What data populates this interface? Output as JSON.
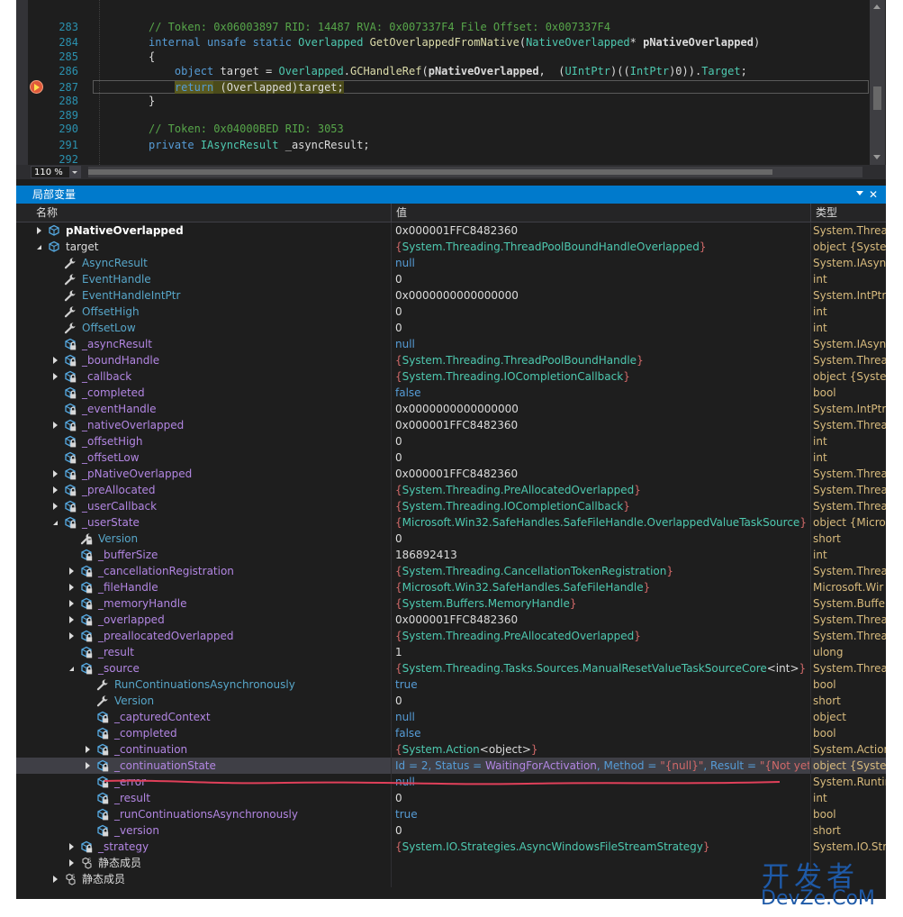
{
  "editor": {
    "zoom": "110 %",
    "lines": [
      {
        "n": "283",
        "segments": [
          [
            "cm",
            "// Token: 0x06003897 RID: 14487 RVA: 0x007337F4 File Offset: 0x007337F4"
          ]
        ]
      },
      {
        "n": "284",
        "segments": [
          [
            "k",
            "internal unsafe static "
          ],
          [
            "ty",
            "Overlapped "
          ],
          [
            "m",
            "GetOverlappedFromNative"
          ],
          [
            "",
            "("
          ],
          [
            "ty",
            "NativeOverlapped"
          ],
          [
            "",
            "* "
          ],
          [
            "b",
            "pNativeOverlapped"
          ],
          [
            "",
            ")"
          ]
        ]
      },
      {
        "n": "285",
        "segments": [
          [
            "",
            "{"
          ]
        ]
      },
      {
        "n": "286",
        "segments": [
          [
            "",
            "    "
          ],
          [
            "k",
            "object "
          ],
          [
            "",
            "target = "
          ],
          [
            "ty",
            "Overlapped"
          ],
          [
            "",
            "."
          ],
          [
            "m",
            "GCHandleRef"
          ],
          [
            "",
            "("
          ],
          [
            "b",
            "pNativeOverlapped"
          ],
          [
            "",
            ",  ("
          ],
          [
            "ty",
            "UIntPtr"
          ],
          [
            "",
            ")(("
          ],
          [
            "ty",
            "IntPtr"
          ],
          [
            "",
            ")0))."
          ],
          [
            "ty",
            "Target"
          ],
          [
            "",
            ";"
          ]
        ]
      },
      {
        "n": "287",
        "segments": [
          [
            "",
            "    "
          ],
          [
            "khl",
            "return"
          ],
          [
            "hl",
            " (Overlapped)target;"
          ]
        ]
      },
      {
        "n": "288",
        "segments": [
          [
            "",
            "}"
          ]
        ]
      },
      {
        "n": "289",
        "segments": []
      },
      {
        "n": "290",
        "segments": [
          [
            "cm",
            "// Token: 0x04000BED RID: 3053"
          ]
        ]
      },
      {
        "n": "291",
        "segments": [
          [
            "k",
            "private "
          ],
          [
            "ty",
            "IAsyncResult "
          ],
          [
            "",
            "_asyncResult;"
          ]
        ]
      },
      {
        "n": "292",
        "segments": []
      }
    ]
  },
  "locals": {
    "title": "局部变量",
    "close": "✕",
    "headers": {
      "name": "名称",
      "value": "值",
      "type": "类型"
    },
    "rows": [
      {
        "d": 0,
        "tw": "col",
        "ic": "field",
        "name": "pNativeOverlapped",
        "nc": "pnb",
        "value": [
          [
            "vd",
            "0x000001FFC8482360"
          ]
        ],
        "type": "System.Threa"
      },
      {
        "d": 0,
        "tw": "exp",
        "ic": "field",
        "name": "target",
        "nc": "vd",
        "value": [
          [
            "br",
            "{"
          ],
          [
            "th",
            "System.Threading."
          ],
          [
            "tk",
            "ThreadPoolBoundHandleOverlapped"
          ],
          [
            "br",
            "}"
          ]
        ],
        "type": "object {Syster"
      },
      {
        "d": 1,
        "tw": "",
        "ic": "wrench",
        "name": "AsyncResult",
        "nc": "vc",
        "value": [
          [
            "kw",
            "null"
          ]
        ],
        "type": "System.IAsync"
      },
      {
        "d": 1,
        "tw": "",
        "ic": "wrench",
        "name": "EventHandle",
        "nc": "vc",
        "value": [
          [
            "vd",
            "0"
          ]
        ],
        "type": "int"
      },
      {
        "d": 1,
        "tw": "",
        "ic": "wrench",
        "name": "EventHandleIntPtr",
        "nc": "vc",
        "value": [
          [
            "vd",
            "0x0000000000000000"
          ]
        ],
        "type": "System.IntPtr"
      },
      {
        "d": 1,
        "tw": "",
        "ic": "wrench",
        "name": "OffsetHigh",
        "nc": "vc",
        "value": [
          [
            "vd",
            "0"
          ]
        ],
        "type": "int"
      },
      {
        "d": 1,
        "tw": "",
        "ic": "wrench",
        "name": "OffsetLow",
        "nc": "vc",
        "value": [
          [
            "vd",
            "0"
          ]
        ],
        "type": "int"
      },
      {
        "d": 1,
        "tw": "",
        "ic": "fieldlock",
        "name": "_asyncResult",
        "nc": "pn",
        "value": [
          [
            "kw",
            "null"
          ]
        ],
        "type": "System.IAsync"
      },
      {
        "d": 1,
        "tw": "col",
        "ic": "fieldlock",
        "name": "_boundHandle",
        "nc": "pn",
        "value": [
          [
            "br",
            "{"
          ],
          [
            "th",
            "System.Threading."
          ],
          [
            "tk",
            "ThreadPoolBoundHandle"
          ],
          [
            "br",
            "}"
          ]
        ],
        "type": "System.Threa"
      },
      {
        "d": 1,
        "tw": "col",
        "ic": "fieldlock",
        "name": "_callback",
        "nc": "pn",
        "value": [
          [
            "br",
            "{"
          ],
          [
            "th",
            "System.Threading."
          ],
          [
            "tk",
            "IOCompletionCallback"
          ],
          [
            "br",
            "}"
          ]
        ],
        "type": "object {Syster"
      },
      {
        "d": 1,
        "tw": "",
        "ic": "fieldlock",
        "name": "_completed",
        "nc": "pn",
        "value": [
          [
            "kw",
            "false"
          ]
        ],
        "type": "bool"
      },
      {
        "d": 1,
        "tw": "",
        "ic": "fieldlock",
        "name": "_eventHandle",
        "nc": "pn",
        "value": [
          [
            "vd",
            "0x0000000000000000"
          ]
        ],
        "type": "System.IntPtr"
      },
      {
        "d": 1,
        "tw": "col",
        "ic": "fieldlock",
        "name": "_nativeOverlapped",
        "nc": "pn",
        "value": [
          [
            "vd",
            "0x000001FFC8482360"
          ]
        ],
        "type": "System.Threa"
      },
      {
        "d": 1,
        "tw": "",
        "ic": "fieldlock",
        "name": "_offsetHigh",
        "nc": "pn",
        "value": [
          [
            "vd",
            "0"
          ]
        ],
        "type": "int"
      },
      {
        "d": 1,
        "tw": "",
        "ic": "fieldlock",
        "name": "_offsetLow",
        "nc": "pn",
        "value": [
          [
            "vd",
            "0"
          ]
        ],
        "type": "int"
      },
      {
        "d": 1,
        "tw": "col",
        "ic": "fieldlock",
        "name": "_pNativeOverlapped",
        "nc": "pn",
        "value": [
          [
            "vd",
            "0x000001FFC8482360"
          ]
        ],
        "type": "System.Threa"
      },
      {
        "d": 1,
        "tw": "col",
        "ic": "fieldlock",
        "name": "_preAllocated",
        "nc": "pn",
        "value": [
          [
            "br",
            "{"
          ],
          [
            "th",
            "System.Threading."
          ],
          [
            "tk",
            "PreAllocatedOverlapped"
          ],
          [
            "br",
            "}"
          ]
        ],
        "type": "System.Threa"
      },
      {
        "d": 1,
        "tw": "col",
        "ic": "fieldlock",
        "name": "_userCallback",
        "nc": "pn",
        "value": [
          [
            "br",
            "{"
          ],
          [
            "th",
            "System.Threading."
          ],
          [
            "tk",
            "IOCompletionCallback"
          ],
          [
            "br",
            "}"
          ]
        ],
        "type": "System.Threa"
      },
      {
        "d": 1,
        "tw": "exp",
        "ic": "fieldlock",
        "name": "_userState",
        "nc": "pn",
        "value": [
          [
            "br",
            "{"
          ],
          [
            "th",
            "Microsoft.Win32.SafeHandles.SafeFileHandle."
          ],
          [
            "tk",
            "OverlappedValueTaskSource"
          ],
          [
            "br",
            "}"
          ]
        ],
        "type": "object {Micro"
      },
      {
        "d": 2,
        "tw": "",
        "ic": "wrenchlock",
        "name": "Version",
        "nc": "vc",
        "value": [
          [
            "vd",
            "0"
          ]
        ],
        "type": "short"
      },
      {
        "d": 2,
        "tw": "",
        "ic": "fieldlock",
        "name": "_bufferSize",
        "nc": "pn",
        "value": [
          [
            "vd",
            "186892413"
          ]
        ],
        "type": "int"
      },
      {
        "d": 2,
        "tw": "col",
        "ic": "fieldlock",
        "name": "_cancellationRegistration",
        "nc": "pn",
        "value": [
          [
            "br",
            "{"
          ],
          [
            "th",
            "System.Threading."
          ],
          [
            "tk",
            "CancellationTokenRegistration"
          ],
          [
            "br",
            "}"
          ]
        ],
        "type": "System.Threa"
      },
      {
        "d": 2,
        "tw": "col",
        "ic": "fieldlock",
        "name": "_fileHandle",
        "nc": "pn",
        "value": [
          [
            "br",
            "{"
          ],
          [
            "th",
            "Microsoft.Win32.SafeHandles."
          ],
          [
            "tk",
            "SafeFileHandle"
          ],
          [
            "br",
            "}"
          ]
        ],
        "type": "Microsoft.Wir"
      },
      {
        "d": 2,
        "tw": "col",
        "ic": "fieldlock",
        "name": "_memoryHandle",
        "nc": "pn",
        "value": [
          [
            "br",
            "{"
          ],
          [
            "th",
            "System.Buffers."
          ],
          [
            "tk",
            "MemoryHandle"
          ],
          [
            "br",
            "}"
          ]
        ],
        "type": "System.Buffer"
      },
      {
        "d": 2,
        "tw": "col",
        "ic": "fieldlock",
        "name": "_overlapped",
        "nc": "pn",
        "value": [
          [
            "vd",
            "0x000001FFC8482360"
          ]
        ],
        "type": "System.Threa"
      },
      {
        "d": 2,
        "tw": "col",
        "ic": "fieldlock",
        "name": "_preallocatedOverlapped",
        "nc": "pn",
        "value": [
          [
            "br",
            "{"
          ],
          [
            "th",
            "System.Threading."
          ],
          [
            "tk",
            "PreAllocatedOverlapped"
          ],
          [
            "br",
            "}"
          ]
        ],
        "type": "System.Threa"
      },
      {
        "d": 2,
        "tw": "",
        "ic": "fieldlock",
        "name": "_result",
        "nc": "pn",
        "value": [
          [
            "vd",
            "1"
          ]
        ],
        "type": "ulong"
      },
      {
        "d": 2,
        "tw": "exp",
        "ic": "fieldlock",
        "name": "_source",
        "nc": "pn",
        "value": [
          [
            "br",
            "{"
          ],
          [
            "th",
            "System.Threading.Tasks.Sources."
          ],
          [
            "tk",
            "ManualResetValueTaskSourceCore"
          ],
          [
            "vd",
            "<int>"
          ],
          [
            "br",
            "}"
          ]
        ],
        "type": "System.Threa"
      },
      {
        "d": 3,
        "tw": "",
        "ic": "wrench",
        "name": "RunContinuationsAsynchronously",
        "nc": "vc",
        "value": [
          [
            "kw",
            "true"
          ]
        ],
        "type": "bool"
      },
      {
        "d": 3,
        "tw": "",
        "ic": "wrench",
        "name": "Version",
        "nc": "vc",
        "value": [
          [
            "vd",
            "0"
          ]
        ],
        "type": "short"
      },
      {
        "d": 3,
        "tw": "",
        "ic": "fieldlock",
        "name": "_capturedContext",
        "nc": "pn",
        "value": [
          [
            "kw",
            "null"
          ]
        ],
        "type": "object"
      },
      {
        "d": 3,
        "tw": "",
        "ic": "fieldlock",
        "name": "_completed",
        "nc": "pn",
        "value": [
          [
            "kw",
            "false"
          ]
        ],
        "type": "bool"
      },
      {
        "d": 3,
        "tw": "col",
        "ic": "fieldlock",
        "name": "_continuation",
        "nc": "pn",
        "value": [
          [
            "br",
            "{"
          ],
          [
            "th",
            "System."
          ],
          [
            "tk",
            "Action"
          ],
          [
            "vd",
            "<object>"
          ],
          [
            "br",
            "}"
          ]
        ],
        "type": "System.Action"
      },
      {
        "d": 3,
        "tw": "col",
        "ic": "fieldlock",
        "name": "_continuationState",
        "nc": "pn",
        "sel": true,
        "value": [
          [
            "kw",
            "Id = 2, Status = "
          ],
          [
            "pn",
            "WaitingForActivation"
          ],
          [
            "kw",
            ", Method = "
          ],
          [
            "br",
            "\"{null}\""
          ],
          [
            "kw",
            ", Result = "
          ],
          [
            "br",
            "\"{Not yet c..."
          ]
        ],
        "type": "object {Syster"
      },
      {
        "d": 3,
        "tw": "",
        "ic": "fieldlock",
        "name": "_error",
        "nc": "pn",
        "value": [
          [
            "kw",
            "null"
          ]
        ],
        "type": "System.Runtir"
      },
      {
        "d": 3,
        "tw": "",
        "ic": "fieldlock",
        "name": "_result",
        "nc": "pn",
        "value": [
          [
            "vd",
            "0"
          ]
        ],
        "type": "int"
      },
      {
        "d": 3,
        "tw": "",
        "ic": "fieldlock",
        "name": "_runContinuationsAsynchronously",
        "nc": "pn",
        "value": [
          [
            "kw",
            "true"
          ]
        ],
        "type": "bool"
      },
      {
        "d": 3,
        "tw": "",
        "ic": "fieldlock",
        "name": "_version",
        "nc": "pn",
        "value": [
          [
            "vd",
            "0"
          ]
        ],
        "type": "short"
      },
      {
        "d": 2,
        "tw": "col",
        "ic": "fieldlock",
        "name": "_strategy",
        "nc": "pn",
        "value": [
          [
            "br",
            "{"
          ],
          [
            "th",
            "System.IO.Strategies."
          ],
          [
            "tk",
            "AsyncWindowsFileStreamStrategy"
          ],
          [
            "br",
            "}"
          ]
        ],
        "type": "System.IO.Str"
      },
      {
        "d": 2,
        "tw": "col",
        "ic": "static",
        "name": "静态成员",
        "nc": "vd",
        "value": [],
        "type": ""
      },
      {
        "d": 1,
        "tw": "col",
        "ic": "static",
        "name": "静态成员",
        "nc": "vd",
        "value": [],
        "type": ""
      }
    ]
  },
  "watermark": {
    "line1": "开发者",
    "line2": "DevZe.CoM"
  },
  "colors": {
    "accent": "#007acc",
    "annotation": "#e0405a"
  }
}
